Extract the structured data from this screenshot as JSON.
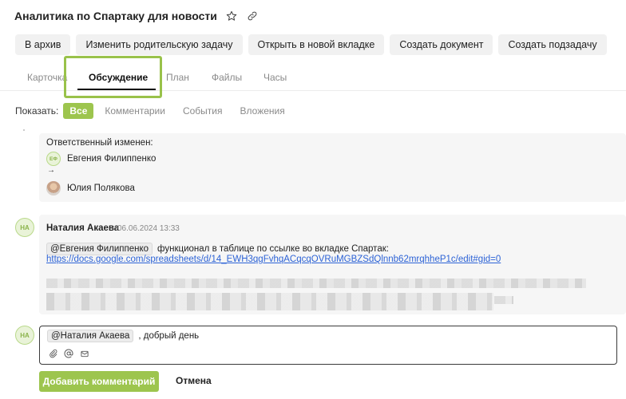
{
  "header": {
    "title": "Аналитика по Спартаку для новости",
    "star_icon": "star-icon",
    "link_icon": "link-icon"
  },
  "toolbar": {
    "archive": "В архив",
    "change_parent": "Изменить родительскую задачу",
    "open_new_tab": "Открыть в новой вкладке",
    "create_doc": "Создать документ",
    "create_subtask": "Создать подзадачу"
  },
  "tabs": [
    {
      "label": "Карточка"
    },
    {
      "label": "Обсуждение"
    },
    {
      "label": "План"
    },
    {
      "label": "Файлы"
    },
    {
      "label": "Часы"
    }
  ],
  "filter": {
    "label": "Показать:",
    "options": [
      "Все",
      "Комментарии",
      "События",
      "Вложения"
    ],
    "selected": "Все"
  },
  "event": {
    "title": "Ответственный изменен:",
    "from_initials": "ЕФ",
    "from_name": "Евгения Филиппенко",
    "arrow": "→",
    "to_name": "Юлия Полякова"
  },
  "comment": {
    "initials": "НА",
    "author": "Наталия Акаева",
    "date": "06.06.2024 13:33",
    "mention": "@Евгения Филиппенко",
    "text": "функционал в таблице по ссылке во вкладке Спартак:",
    "link": "https://docs.google.com/spreadsheets/d/14_EWH3qgFvhqACqcqOVRuMGBZSdQlnnb62mrqhheP1c/edit#gid=0"
  },
  "editor": {
    "initials": "НА",
    "mention": "@Наталия Акаева",
    "text": ", добрый день"
  },
  "actions": {
    "submit": "Добавить комментарий",
    "cancel": "Отмена"
  },
  "colors": {
    "accent": "#9dc54e",
    "link": "#2d63d6"
  }
}
